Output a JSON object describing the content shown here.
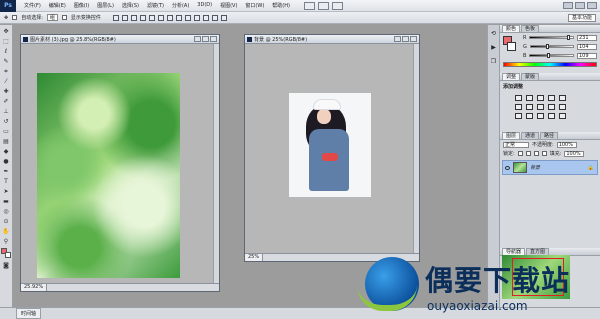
{
  "app": {
    "logo": "Ps"
  },
  "menu": [
    "文件(F)",
    "编辑(E)",
    "图像(I)",
    "图层(L)",
    "选择(S)",
    "滤镜(T)",
    "分析(A)",
    "3D(D)",
    "视图(V)",
    "窗口(W)",
    "帮助(H)"
  ],
  "options": {
    "auto_select": "自动选择:",
    "auto_select_value": "组",
    "show_transform": "显示变换控件"
  },
  "workspace": "基本功能",
  "doc1": {
    "title": "图片素材 (3).jpg @ 25.8%(RGB/8#)",
    "zoom": "25.92%"
  },
  "doc2": {
    "title": "背景 @ 25%(RGB/8#)",
    "zoom": "25%"
  },
  "color_panel": {
    "tabs": [
      "颜色",
      "色板"
    ],
    "rows": [
      {
        "label": "R",
        "value": "231",
        "pos": 0.91
      },
      {
        "label": "G",
        "value": "104",
        "pos": 0.41
      },
      {
        "label": "B",
        "value": "109",
        "pos": 0.43
      }
    ],
    "foreground": "#e7686d"
  },
  "adjust_panel": {
    "tabs": [
      "调整",
      "蒙版"
    ],
    "title": "添加调整"
  },
  "layers_panel": {
    "tabs": [
      "图层",
      "通道",
      "路径"
    ],
    "blend_mode": "正常",
    "opacity_label": "不透明度:",
    "opacity": "100%",
    "lock_label": "锁定:",
    "fill_label": "填充:",
    "fill": "100%",
    "layer_name": "背景"
  },
  "navigator": {
    "tabs": [
      "导航器",
      "直方图"
    ]
  },
  "status": {
    "timeline": "时间轴"
  },
  "watermark": {
    "cn": "偶要下载站",
    "en": "ouyaoxiazai.com"
  }
}
